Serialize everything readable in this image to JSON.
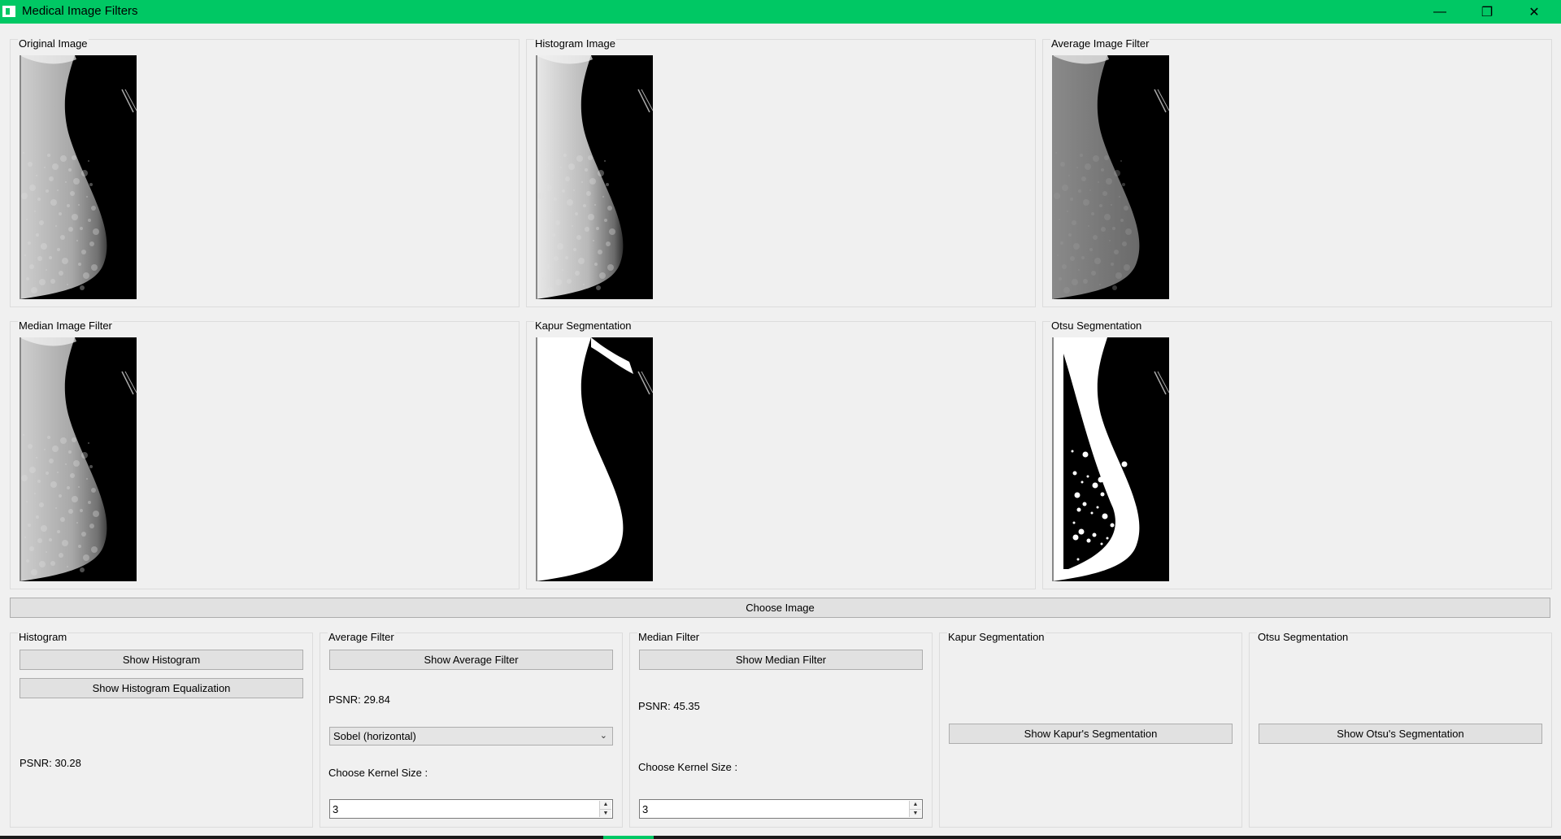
{
  "window": {
    "title": "Medical Image Filters",
    "minimize_glyph": "—",
    "maximize_glyph": "❐",
    "close_glyph": "✕"
  },
  "image_panels": [
    {
      "title": "Original Image",
      "render": "original"
    },
    {
      "title": "Histogram Image",
      "render": "histogram"
    },
    {
      "title": "Average Image Filter",
      "render": "sobel"
    },
    {
      "title": "Median Image Filter",
      "render": "original"
    },
    {
      "title": "Kapur Segmentation",
      "render": "kapur"
    },
    {
      "title": "Otsu Segmentation",
      "render": "otsu"
    }
  ],
  "choose_image_label": "Choose Image",
  "histogram": {
    "title": "Histogram",
    "show_histogram_label": "Show Histogram",
    "show_equalization_label": "Show Histogram Equalization",
    "psnr": "PSNR: 30.28"
  },
  "average_filter": {
    "title": "Average Filter",
    "show_label": "Show Average Filter",
    "psnr": "PSNR: 29.84",
    "selected_option": "Sobel (horizontal)",
    "kernel_label": "Choose Kernel Size :",
    "kernel_value": "3"
  },
  "median_filter": {
    "title": "Median Filter",
    "show_label": "Show Median Filter",
    "psnr": "PSNR: 45.35",
    "kernel_label": "Choose Kernel Size :",
    "kernel_value": "3"
  },
  "kapur": {
    "title": "Kapur Segmentation",
    "show_label": "Show Kapur's Segmentation"
  },
  "otsu": {
    "title": "Otsu Segmentation",
    "show_label": "Show Otsu's Segmentation"
  },
  "colors": {
    "titlebar": "#00c864",
    "window_bg": "#f0f0f0",
    "button_bg": "#e1e1e1"
  }
}
